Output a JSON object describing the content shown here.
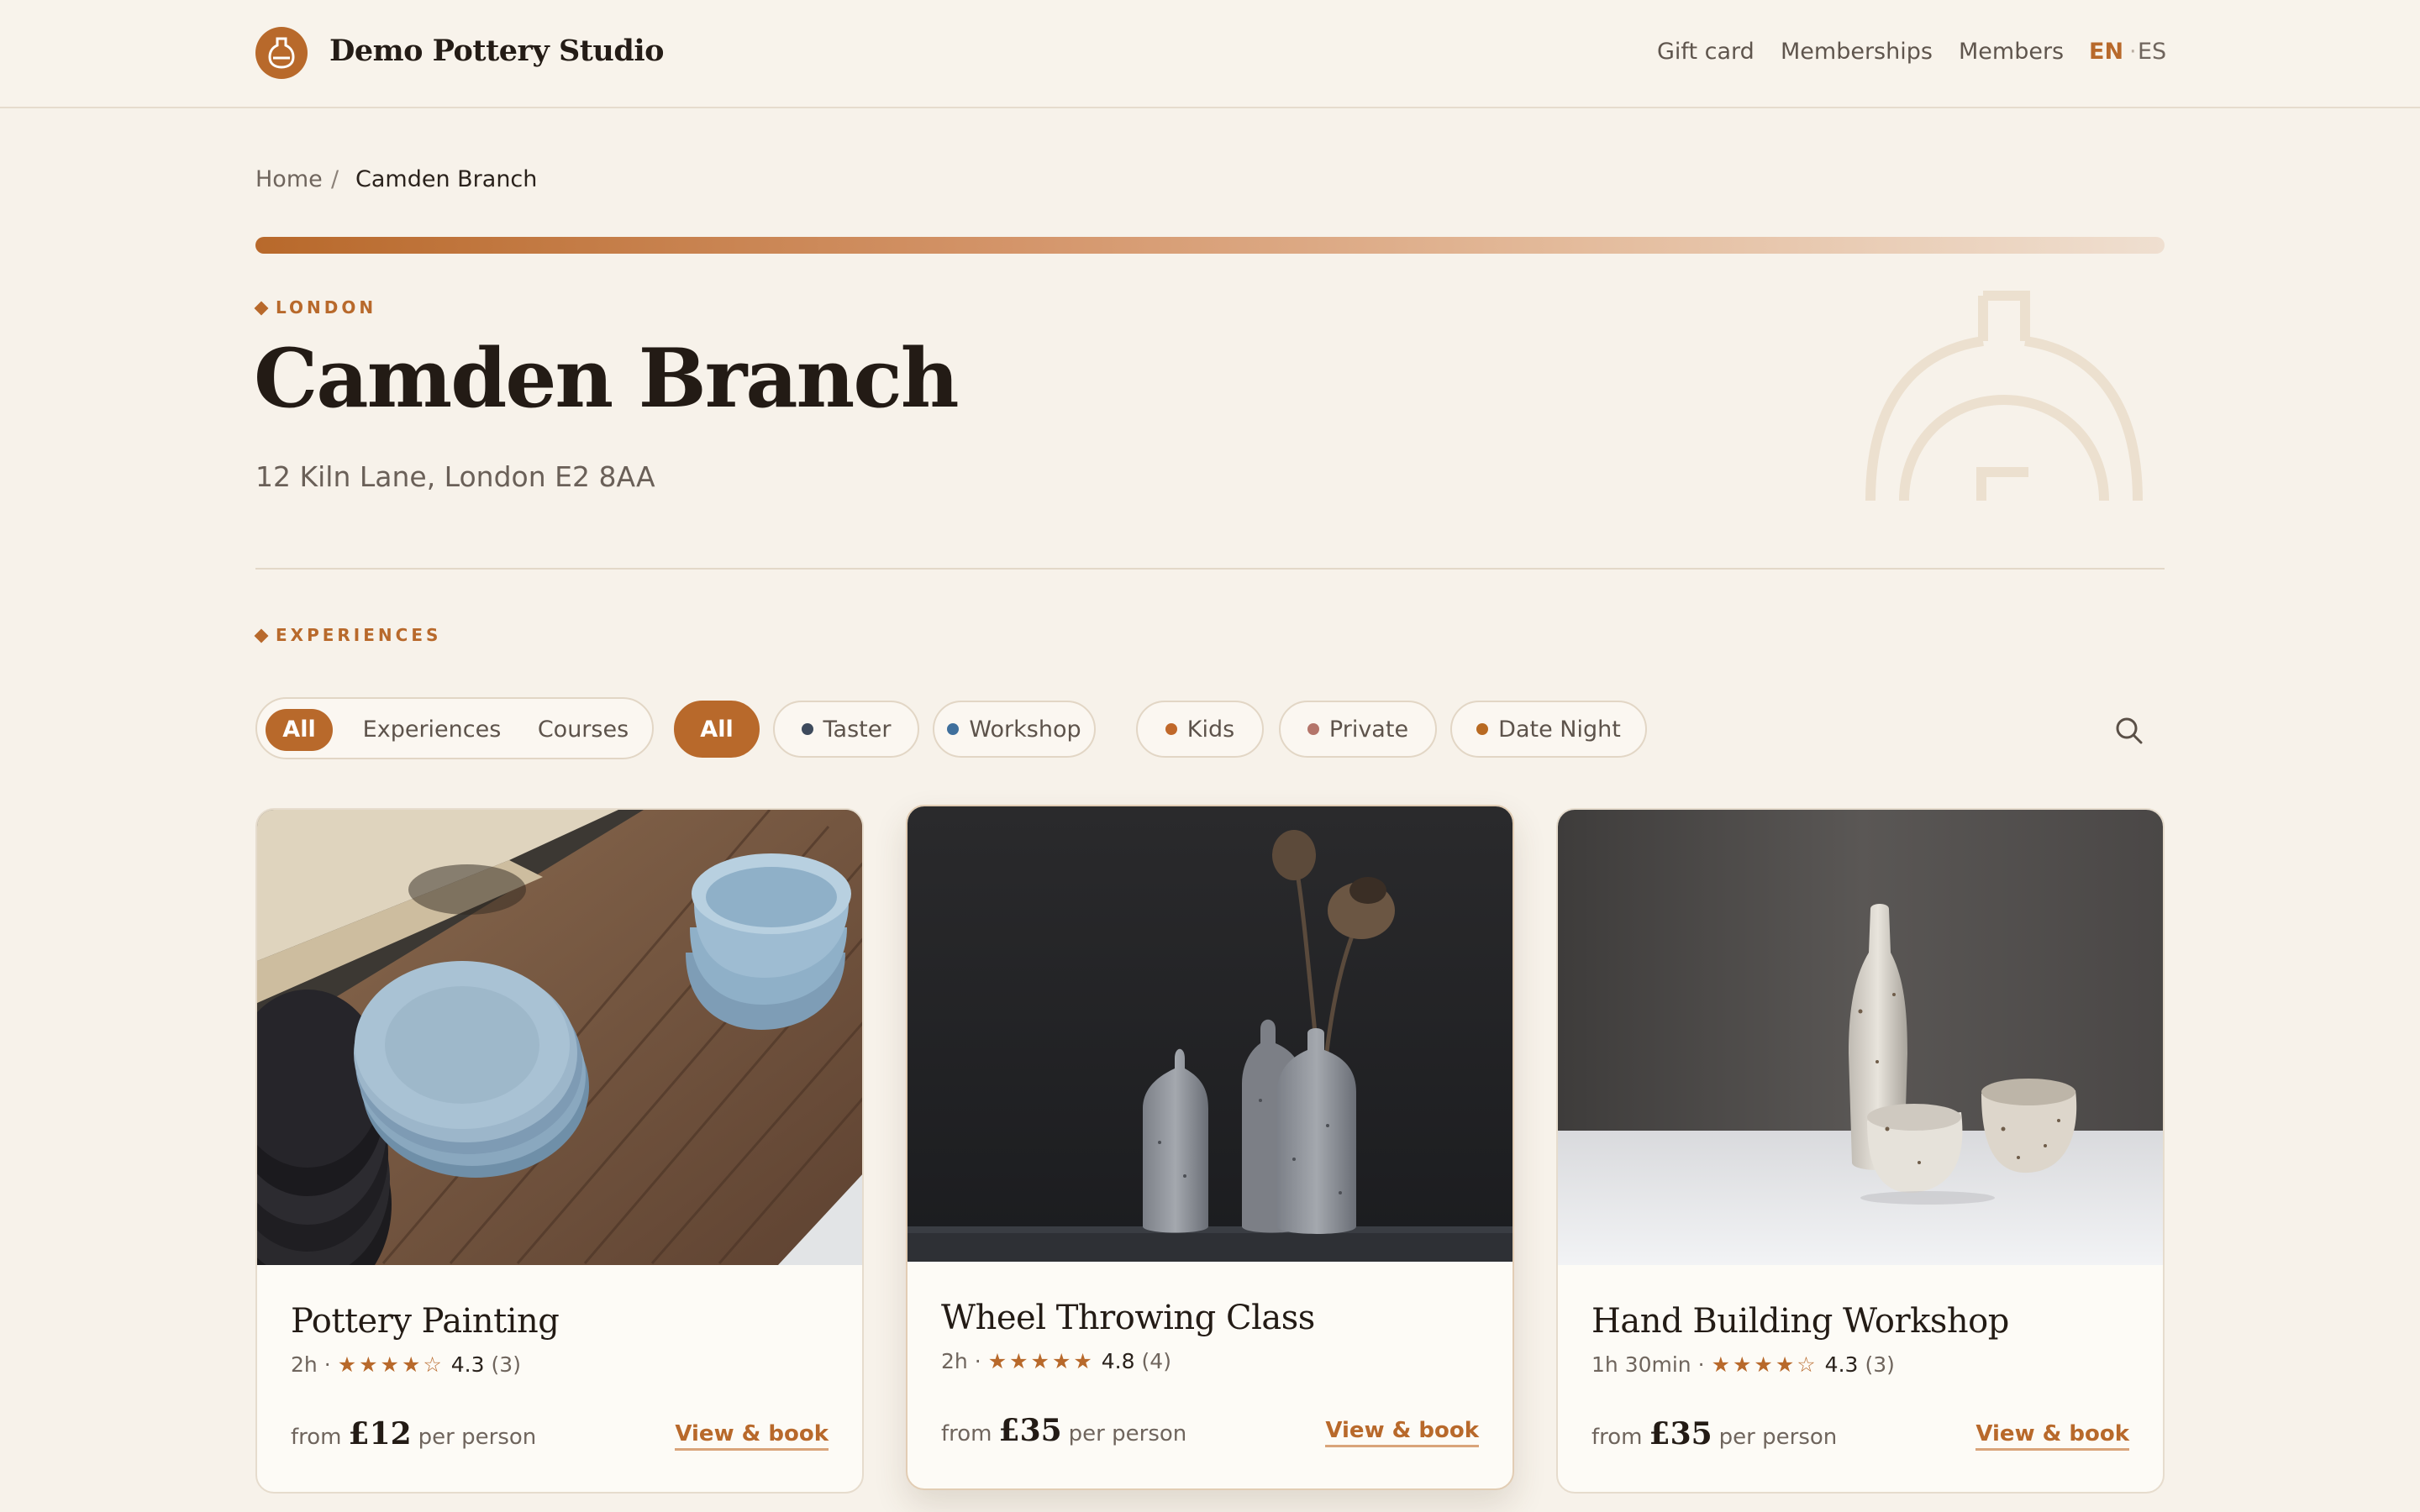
{
  "header": {
    "brand": "Demo Pottery Studio",
    "nav": [
      "Gift card",
      "Memberships",
      "Members"
    ],
    "lang": {
      "active": "EN",
      "separator": "·",
      "other": "ES"
    }
  },
  "breadcrumb": {
    "home": "Home",
    "separator": "/",
    "current": "Camden Branch"
  },
  "branch": {
    "eyebrow": "LONDON",
    "title": "Camden Branch",
    "address": "12 Kiln Lane, London E2 8AA"
  },
  "experiences": {
    "eyebrow": "EXPERIENCES",
    "segments": [
      "All",
      "Experiences",
      "Courses"
    ],
    "active_segment": "All",
    "chips": [
      {
        "label": "All",
        "active": true
      },
      {
        "label": "Taster",
        "dot": "#3d4a5c"
      },
      {
        "label": "Workshop",
        "dot": "#3f6f9c"
      },
      {
        "label": "Kids",
        "dot": "#c0682a"
      },
      {
        "label": "Private",
        "dot": "#b4756a"
      },
      {
        "label": "Date Night",
        "dot": "#b86a22"
      }
    ]
  },
  "cards": [
    {
      "title": "Pottery Painting",
      "duration": "2h",
      "meta_sep": "·",
      "stars": "★★★★☆",
      "rating": "4.3",
      "reviews": "(3)",
      "from": "from",
      "price": "£12",
      "unit": "per person",
      "cta": "View & book",
      "image": "stacked-plates-and-bowls-photo"
    },
    {
      "title": "Wheel Throwing Class",
      "duration": "2h",
      "meta_sep": "·",
      "stars": "★★★★★",
      "rating": "4.8",
      "reviews": "(4)",
      "from": "from",
      "price": "£35",
      "unit": "per person",
      "cta": "View & book",
      "image": "ceramic-vases-with-dried-poppies-photo"
    },
    {
      "title": "Hand Building Workshop",
      "duration": "1h 30min",
      "meta_sep": "·",
      "stars": "★★★★☆",
      "rating": "4.3",
      "reviews": "(3)",
      "from": "from",
      "price": "£35",
      "unit": "per person",
      "cta": "View & book",
      "image": "speckled-bottle-and-cups-photo"
    }
  ],
  "colors": {
    "accent": "#b8692b",
    "background": "#f7f2ea",
    "card": "#fdfbf6"
  }
}
